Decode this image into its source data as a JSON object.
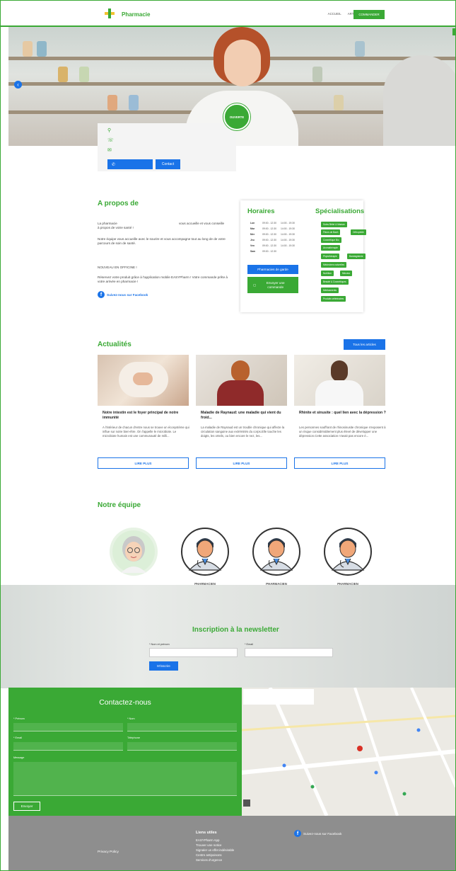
{
  "header": {
    "brand": "Pharmacie",
    "nav": [
      "ACCUEIL",
      "ARTICLES",
      "CONTACT"
    ],
    "order_label": "COMMANDER"
  },
  "hero": {
    "status_badge": "OUVERTE",
    "contact_button": "Contact"
  },
  "about": {
    "title": "A propos de",
    "p1_left": "La pharmacie",
    "p1_right": "vous accueille et vous conseille",
    "p1_cont": "à propos de votre santé !",
    "p2": "Notre équipe vous accueille avec le sourire et vous accompagne tout au long de de votre parcours de soin de santé.",
    "news_title": "NOUVEAU EN OFFICINE !",
    "news_text": "Réservez votre produit grâce à l'application mobile EASYPharm ! Votre commande prête à votre arrivée en pharmacie !",
    "facebook": "Suivez-nous sur Facebook"
  },
  "hours": {
    "title": "Horaires",
    "rows": [
      {
        "day": "Lun",
        "am": "09:00 - 12:30",
        "pm": "14:00 - 19:30"
      },
      {
        "day": "Mar",
        "am": "09:00 - 12:30",
        "pm": "14:00 - 19:30"
      },
      {
        "day": "Mer",
        "am": "09:00 - 12:30",
        "pm": "14:00 - 19:30"
      },
      {
        "day": "Jeu",
        "am": "09:00 - 12:30",
        "pm": "14:00 - 19:30"
      },
      {
        "day": "Ven",
        "am": "09:00 - 12:30",
        "pm": "14:00 - 19:30"
      },
      {
        "day": "Sam",
        "am": "09:00 - 12:30",
        "pm": ""
      }
    ],
    "garde_button": "Pharmacies de garde",
    "order_button": "Envoyer une commande"
  },
  "specialisations": {
    "title": "Spécialisations",
    "tags": [
      "Soins Bébé & Maman",
      "Fleurs de Bach",
      "Orthopédie",
      "Cosmétique Bio",
      "Aromathérapie",
      "Phytothérapie",
      "Bandagisterie",
      "Médecines naturelles",
      "Nutrition",
      "Minceur",
      "Beauté & Cosmétiques",
      "Médicaments",
      "Produits vétérinaires"
    ]
  },
  "news": {
    "title": "Actualités",
    "all_button": "Tous les articles",
    "read_more": "LIRE PLUS",
    "articles": [
      {
        "title": "Notre intestin est le foyer principal de notre immunité",
        "excerpt": "A l'intérieur de chacun d'entre nous se trouve un écosystème qui influe sur notre bien-être. On l'appelle le microbiote. Le microbiote humain est une communauté de milli..."
      },
      {
        "title": "Maladie de Raynaud: une maladie qui vient du froid...",
        "excerpt": "La maladie de Raynaud est un trouble chronique qui affecte la circulation sanguine aux extrémités du corps.Elle touche les doigts, les orteils, ou bien encore le nez, les..."
      },
      {
        "title": "Rhinite et sinusite : quel lien avec la dépression ?",
        "excerpt": "Les personnes souffrant de rhinosinusite chronique s'exposent à un risque considérablement plus élevé de développer une dépression.Cette association n'avait pas encore é..."
      }
    ]
  },
  "team": {
    "title": "Notre équipe",
    "members": [
      "PHARMACIEN",
      "PHARMACIEN",
      "PHARMACIEN"
    ]
  },
  "newsletter": {
    "title": "Inscription à la newsletter",
    "name_label": "* Nom et prénom",
    "email_label": "* Email",
    "submit": "M'inscrire"
  },
  "contact": {
    "title": "Contactez-nous",
    "prenom": "* Prénom",
    "nom": "* Nom",
    "email": "* Email",
    "telephone": "Téléphone",
    "message": "Message",
    "send": "Envoyer"
  },
  "footer": {
    "privacy": "Privacy Policy",
    "links_title": "Liens utiles",
    "links": [
      "EASYPharm App",
      "Trouver une notice",
      "Signaler un effet indésirable",
      "Centre antipoisons",
      "Services d'urgence"
    ],
    "facebook": "Suivez-nous sur Facebook"
  },
  "colors": {
    "brand_green": "#3aa935",
    "action_blue": "#1a73e8"
  }
}
